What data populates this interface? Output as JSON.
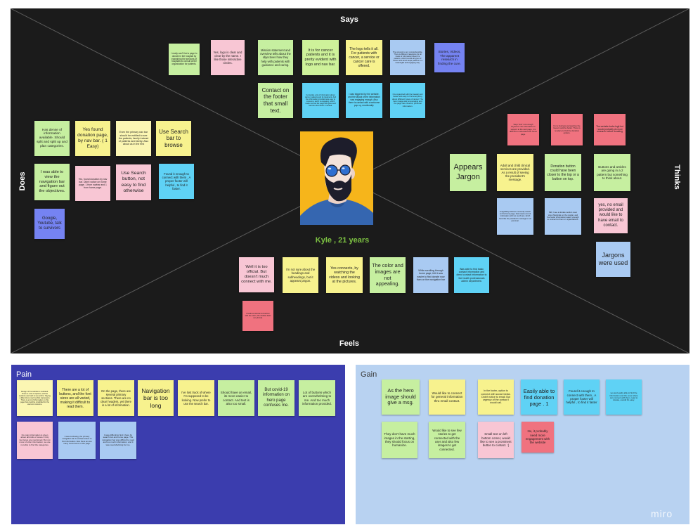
{
  "board": {
    "labels": {
      "says": "Says",
      "feels": "Feels",
      "does": "Does",
      "thinks": "Thinks"
    },
    "persona": {
      "name": "Kyle , 21 years"
    }
  },
  "colors": {
    "board": "#1b1b1b",
    "pain_panel": "#3b3dae",
    "gain_panel": "#b8d2f1",
    "persona_name": "#7dc242"
  },
  "says": [
    {
      "text": "I really can't find a page to donate in the hospital by examining the services of hospitals to consult at the organization for patients.",
      "color": "#c6efa0"
    },
    {
      "text": "Yes, logo is clear and clear by the name. I like those interactive circles.",
      "color": "#f8c6d4"
    },
    {
      "text": "Mission statement and overview tells about the objectives how they help with patients with guidance and caring.",
      "color": "#c6efa0"
    },
    {
      "text": "It is for cancer patients and it is pretty evident with logo and nav bar.",
      "color": "#cef29a"
    },
    {
      "text": "The logo tells it all. For patients with cancer, a service or cancer care is offered.",
      "color": "#f7f28e"
    },
    {
      "text": "The concept is very comprehensible. There is different categories for all levels of information about the patients, which benefit all types of cancer and which helps patients in a meaningful and engaging way.",
      "color": "#a9caf2"
    },
    {
      "text": "Stories, Videos, The apparent research in finding the cure.",
      "color": "#7583f2"
    },
    {
      "text": "Contact on the footer that small text.",
      "color": "#c6efa0"
    },
    {
      "text": "It provides a lot of information about cancer, patients and its treatment. And the information provided was easy to consume, and it is engaging, which made me feel the page was good and had the information I needed.",
      "color": "#5fd2f5"
    },
    {
      "text": "I was triggered by the website, and the layout of the information was engaging enough. Also there is contact with a welcome pop up, emotionally.",
      "color": "#5fd2f5"
    },
    {
      "text": "It is organized with the header and footer and easy to find everything about different types of cancer. The hero image was encouraging and the page has cheerful, personal information.",
      "color": "#5fd2f5"
    }
  ],
  "does": [
    {
      "text": "Has dense of information available. Should split and split up and plan categories.",
      "color": "#c6efa0"
    },
    {
      "text": "Yes found donation page, by nav bar. ( 1 Easy)",
      "color": "#f7f28e"
    },
    {
      "text": "Even the primary nav bar should be entitled to see the patients, family instead of patients and family. Also about us in the first",
      "color": "#fbf6b3"
    },
    {
      "text": "Use Search bar to browse",
      "color": "#f7f28e"
    },
    {
      "text": "I was able to view the navigation bar and figure out the objectives.",
      "color": "#c6efa0"
    },
    {
      "text": "Yes, found donation by nav bar. Didn't notice on home page. 1 from navbar and 1 from home page.",
      "color": "#f8c6d4"
    },
    {
      "text": "Use Search button, not easy to find otherwise",
      "color": "#f8c6d4"
    },
    {
      "text": "Found it enough to connect with them , A proper footer will helpful , to find it faster.",
      "color": "#5fd2f5"
    },
    {
      "text": "Google, Youtube, talk to survivors",
      "color": "#7583f2"
    }
  ],
  "thinks": [
    {
      "text": "Says 'Join' not enough keyword. The information to support at the web page, it is difficult to understand the home page.",
      "color": "#f0727f"
    },
    {
      "text": "For a business perspective the layout could be better. There is no place to find the donation options.",
      "color": "#f0727f"
    },
    {
      "text": "The website looks legit but I would probably do more research before donating",
      "color": "#f0727f"
    },
    {
      "text": "Appears Jargon",
      "color": "#c6efa0"
    },
    {
      "text": "Adult and child clinical services are provided. As a result of seeing the president's message.",
      "color": "#f7f28e"
    },
    {
      "text": "Donation button could have been closer to the top or a button on top.",
      "color": "#c6efa0"
    },
    {
      "text": "Buttons and articles are going in a 2 pattern but something to think about.",
      "color": "#c6efa0"
    },
    {
      "text": "Image/Why did there connectly search on first home page, that means a lot of information with too much text, which feels like the president's message is not personal.",
      "color": "#a9caf2"
    },
    {
      "text": "Still, I see a donate section even when Medicals on the navbar, and the footer information wasn't enough to connect to them or organizations.",
      "color": "#a9caf2"
    },
    {
      "text": "yes, no email provided and would like to have email to contact.",
      "color": "#f8c6d4"
    },
    {
      "text": "Jargons were used",
      "color": "#a9caf2"
    }
  ],
  "feels": [
    {
      "text": "Well it is too official. But doesn't much connect with me.",
      "color": "#f8c6d4"
    },
    {
      "text": "I'm not sure about the headings and subheadings, but it appears jargon.",
      "color": "#f7f28e"
    },
    {
      "text": "Yes connects, by watching the videos and looking at the pictures.",
      "color": "#f7f28e"
    },
    {
      "text": "The color and images are not appealing.",
      "color": "#c6efa0"
    },
    {
      "text": "While scrolling through home page, felt it was easier to find donate now than on the navigation bar",
      "color": "#a9caf2"
    },
    {
      "text": "Was able to find basic contact information and direct contact information to the health professionals admin department.",
      "color": "#5fd2f5"
    },
    {
      "text": "It lacks emotional connection with the users, the website feels very formal.",
      "color": "#f0727f"
    }
  ],
  "pain": {
    "label": "Pain",
    "notes": [
      {
        "text": "Design of the website is outdated. There is a lot of options, and the sections are hard to use at first. Saying a little bit too much at first impression. There is a lot of information on this page that could be simplified for the users to consume.",
        "color": "#fbf6b3"
      },
      {
        "text": "There are a lot of buttons, and the font sizes are all varied, making it difficult to read them.",
        "color": "#f7f28e"
      },
      {
        "text": "On the page, there are several primary sections. There are no clear headers, yet there is a lot of information.",
        "color": "#f7f28e"
      },
      {
        "text": "Navigation bar is too long",
        "color": "#f7f28e"
      },
      {
        "text": "I've lost track of where I'm supposed to be looking. Now prefer to use the search bar.",
        "color": "#f7f28e"
      },
      {
        "text": "Should have an email, its more easier to contact. And text is also too small.",
        "color": "#c6efa0"
      },
      {
        "text": "But covid-19 information on hero page confuses me.",
        "color": "#c6efa0"
      },
      {
        "text": "Lot of buttons which are overwhelming to me. And too much information provided.",
        "color": "#c6efa0"
      },
      {
        "text": "No main information is given about all kinds of cancer. Only few types are mentioned. But not more of other information, we are not able to find the categories.",
        "color": "#f8c6d4"
      },
      {
        "text": "It was confusing, the primary navigation bar is unclear where to find information. Also there are too many menu items on the page.",
        "color": "#a9caf2"
      },
      {
        "text": "It was difficult to find it here by search bar and home page. The navigation bar was difficult to read and too much information, and it was overwhelming for me.",
        "color": "#a9caf2"
      }
    ]
  },
  "gain": {
    "label": "Gain",
    "notes": [
      {
        "text": "As the hero image should give a msg.",
        "color": "#c6efa0"
      },
      {
        "text": "Would like to connect for general information thru email contact.",
        "color": "#f7f28e"
      },
      {
        "text": "In the footer, option to connect with social media. Didn't notice to email. But urgency of the contact I would call.",
        "color": "#f7f28e"
      },
      {
        "text": "Easily able to find donation page . 1",
        "color": "#5fd2f5"
      },
      {
        "text": "Found it enough to connect with them , A proper footer will helpful , to find it faster",
        "color": "#5fd2f5"
      },
      {
        "text": "yes and easily able to find the information and the ones where can connect with them, read to donate, overall it's easy.",
        "color": "#5fd2f5"
      },
      {
        "text": "They don't have much images in the starting, they should focus on humanize.",
        "color": "#c6efa0"
      },
      {
        "text": "Would like to see few stories to get connected with the user and also few images to get connected.",
        "color": "#c6efa0"
      },
      {
        "text": "Small text on left bottom corner, would like to see a prominent button to contact. :)",
        "color": "#f8c6d4"
      },
      {
        "text": "No, it probably need more engagement with the website",
        "color": "#f0727f"
      }
    ]
  },
  "branding": {
    "logo": "miro"
  }
}
